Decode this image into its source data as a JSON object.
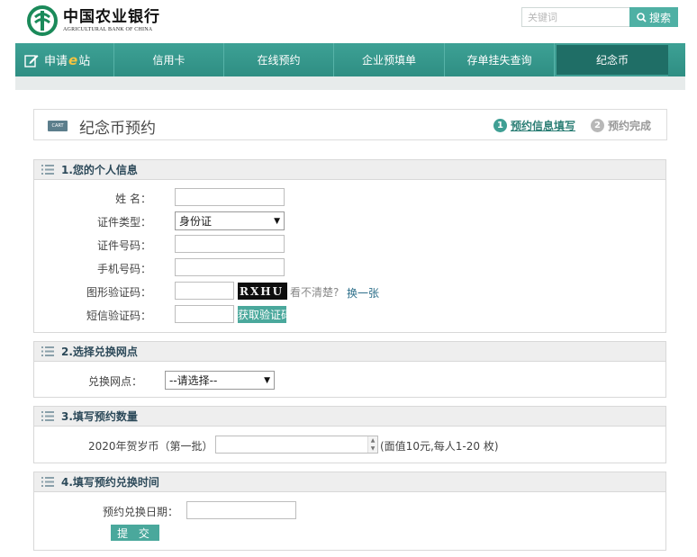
{
  "header": {
    "logo_cn": "中国农业银行",
    "logo_en": "AGRICULTURAL BANK OF CHINA",
    "search_placeholder": "关键词",
    "search_button": "搜索"
  },
  "nav": {
    "apply_prefix": "申请",
    "apply_e": "e",
    "apply_suffix": "站",
    "items": [
      "信用卡",
      "在线预约",
      "企业预填单",
      "存单挂失查询",
      "纪念币"
    ],
    "active": "纪念币"
  },
  "page": {
    "icon_text": "CART",
    "title": "纪念币预约",
    "steps": [
      {
        "num": "1",
        "label": "预约信息填写"
      },
      {
        "num": "2",
        "label": "预约完成"
      }
    ]
  },
  "section1": {
    "title": "1.您的个人信息",
    "name_label": "姓  名：",
    "id_type_label": "证件类型：",
    "id_type_value": "身份证",
    "id_number_label": "证件号码：",
    "phone_label": "手机号码：",
    "captcha_label": "图形验证码：",
    "captcha_text": "RXHU",
    "captcha_hint": "看不清楚?",
    "captcha_refresh": "换一张",
    "sms_label": "短信验证码：",
    "sms_button": "获取验证码"
  },
  "section2": {
    "title": "2.选择兑换网点",
    "branch_label": "兑换网点：",
    "branch_value": "--请选择--"
  },
  "section3": {
    "title": "3.填写预约数量",
    "coin_label": "2020年贺岁币（第一批）",
    "coin_note": "(面值10元,每人1-20 枚)"
  },
  "section4": {
    "title": "4.填写预约兑换时间",
    "date_label": "预约兑换日期：",
    "submit": "提 交"
  }
}
